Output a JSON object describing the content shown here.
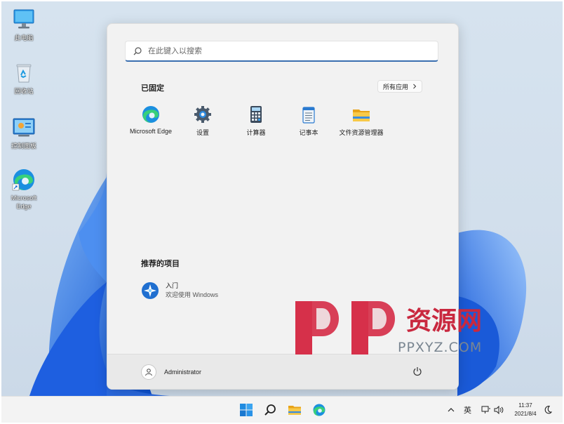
{
  "desktop": {
    "icons": [
      {
        "label": "此电脑",
        "icon": "computer-icon"
      },
      {
        "label": "回收站",
        "icon": "recycle-bin-icon"
      },
      {
        "label": "控制面板",
        "icon": "control-panel-icon"
      },
      {
        "label": "Microsoft\nEdge",
        "icon": "edge-icon"
      }
    ]
  },
  "start_menu": {
    "search": {
      "placeholder": "在此键入以搜索"
    },
    "pinned": {
      "title": "已固定",
      "all_apps_label": "所有应用",
      "apps": [
        {
          "label": "Microsoft Edge",
          "icon": "edge-icon"
        },
        {
          "label": "设置",
          "icon": "settings-gear-icon"
        },
        {
          "label": "计算器",
          "icon": "calculator-icon"
        },
        {
          "label": "记事本",
          "icon": "notepad-icon"
        },
        {
          "label": "文件资源管理器",
          "icon": "folder-icon"
        }
      ]
    },
    "recommended": {
      "title": "推荐的项目",
      "items": [
        {
          "title": "入门",
          "subtitle": "欢迎使用 Windows",
          "icon": "get-started-icon"
        }
      ]
    },
    "user": {
      "name": "Administrator"
    }
  },
  "watermark": {
    "letters": "PP",
    "text": "资源网",
    "domain": "PPXYZ.COM"
  },
  "taskbar": {
    "apps": [
      "start-icon",
      "search-icon",
      "file-explorer-icon",
      "edge-icon"
    ],
    "tray": {
      "ime_label": "英"
    },
    "clock": {
      "time": "11:37",
      "date": "2021/8/4"
    }
  },
  "colors": {
    "accent": "#3a6fb0",
    "bloom": "#1f63d8",
    "watermark_red": "#d6304a"
  }
}
